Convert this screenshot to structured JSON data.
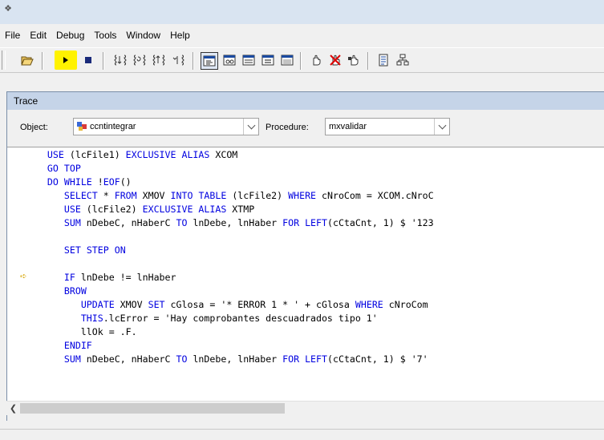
{
  "menu": [
    "File",
    "Edit",
    "Debug",
    "Tools",
    "Window",
    "Help"
  ],
  "toolbar": {
    "icons": [
      "open-icon",
      "run-icon",
      "stop-icon",
      "step-into-icon",
      "step-over-icon",
      "step-out-icon",
      "run-to-cursor-icon",
      "trace-window-icon",
      "watch-window-icon",
      "locals-window-icon",
      "call-stack-icon",
      "output-window-icon",
      "breakpoint-icon",
      "clear-breakpoints-icon",
      "toggle-breakpoint-icon",
      "coverage-icon",
      "event-tracking-icon"
    ]
  },
  "trace": {
    "title": "Trace",
    "object_label": "Object:",
    "object_value": "ccntintegrar",
    "procedure_label": "Procedure:",
    "procedure_value": "mxvalidar"
  },
  "code": [
    "    USE (lcFile1) EXCLUSIVE ALIAS XCOM",
    "    GO TOP",
    "    DO WHILE !EOF()",
    "       SELECT * FROM XMOV INTO TABLE (lcFile2) WHERE cNroCom = XCOM.cNroC",
    "       USE (lcFile2) EXCLUSIVE ALIAS XTMP",
    "       SUM nDebeC, nHaberC TO lnDebe, lnHaber FOR LEFT(cCtaCnt, 1) $ '123",
    "",
    "       SET STEP ON",
    "",
    "       IF lnDebe != lnHaber",
    "       BROW",
    "          UPDATE XMOV SET cGlosa = '* ERROR 1 * ' + cGlosa WHERE cNroCom",
    "          THIS.lcError = 'Hay comprobantes descuadrados tipo 1'",
    "          llOk = .F.",
    "       ENDIF",
    "       SUM nDebeC, nHaberC TO lnDebe, lnHaber FOR LEFT(cCtaCnt, 1) $ '7'"
  ],
  "current_line_index": 9,
  "colors": {
    "keyword": "#0000e0",
    "highlight": "#fff200"
  }
}
